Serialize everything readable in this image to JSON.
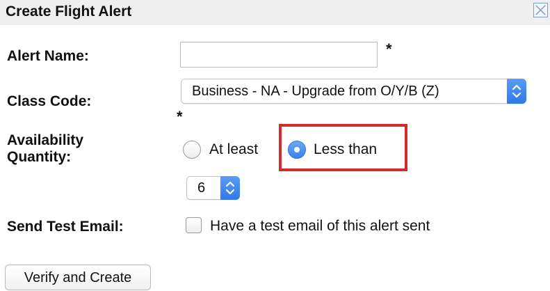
{
  "dialog": {
    "title": "Create Flight Alert",
    "close_icon": "close-box-icon"
  },
  "form": {
    "alert_name": {
      "label": "Alert Name:",
      "value": "",
      "required_marker": "*"
    },
    "class_code": {
      "label": "Class Code:",
      "selected": "Business - NA - Upgrade from O/Y/B (Z)",
      "required_marker": "*"
    },
    "availability": {
      "label_line1": "Availability",
      "label_line2": "Quantity:",
      "options": [
        {
          "label": "At least",
          "selected": false
        },
        {
          "label": "Less than",
          "selected": true
        }
      ],
      "quantity": "6"
    },
    "test_email": {
      "label": "Send Test Email:",
      "checkbox_label": "Have a test email of this alert sent",
      "checked": false
    }
  },
  "actions": {
    "submit_label": "Verify and Create"
  },
  "colors": {
    "highlight": "#d22b2b",
    "accent": "#3a82ee",
    "titlebar": "#efefef"
  }
}
